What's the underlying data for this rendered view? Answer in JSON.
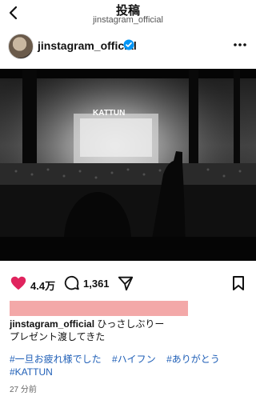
{
  "nav": {
    "title": "投稿",
    "subtitle": "jinstagram_official"
  },
  "post": {
    "username": "jinstagram_official",
    "image_label": "KATTUN",
    "likes": "4.4万",
    "comments": "1,361",
    "caption_user": "jinstagram_official",
    "caption_line1": "ひっさしぶりー",
    "caption_line2": "プレゼント渡してきた",
    "hashtags": [
      "#一旦お疲れ様でした",
      "#ハイフン",
      "#ありがとう",
      "#KATTUN"
    ],
    "timestamp": "27 分前"
  },
  "colors": {
    "heart": "#e0245e",
    "verified": "#0095f6",
    "hashtag": "#1f5fb7",
    "redaction": "#f3a8a8"
  },
  "icons": {
    "back": "chevron-left-icon",
    "verified": "verified-badge-icon",
    "more": "more-horizontal-icon",
    "like": "heart-icon",
    "comment": "comment-icon",
    "share": "send-icon",
    "save": "bookmark-icon"
  }
}
